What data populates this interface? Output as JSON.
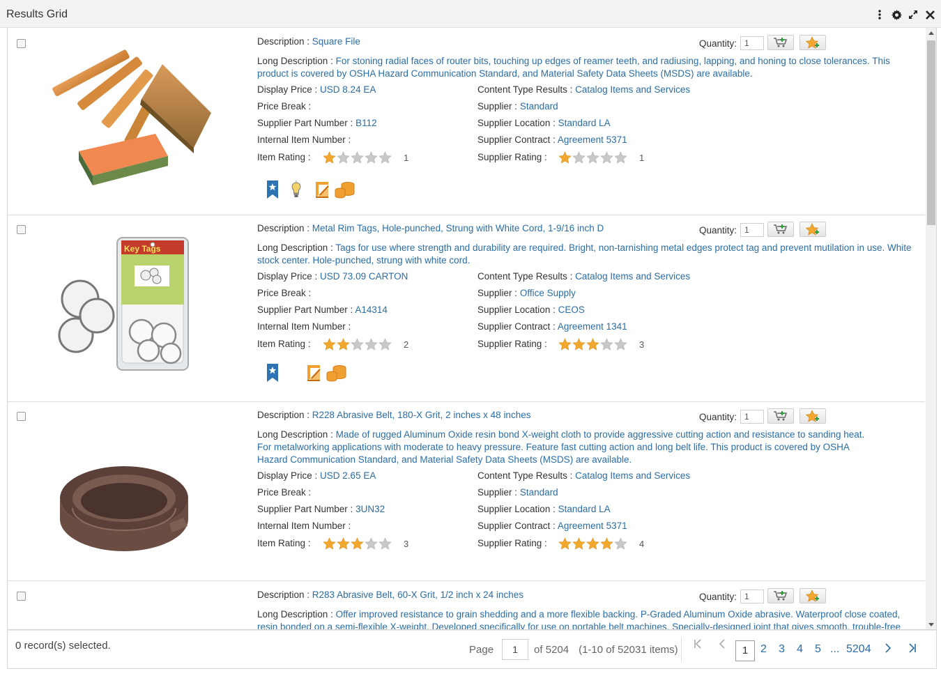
{
  "window": {
    "title": "Results Grid"
  },
  "labels": {
    "description": "Description :",
    "long_description": "Long Description :",
    "display_price": "Display Price :",
    "price_break": "Price Break :",
    "supplier_part_number": "Supplier Part Number :",
    "internal_item_number": "Internal Item Number :",
    "item_rating": "Item Rating :",
    "content_type_results": "Content Type Results :",
    "supplier": "Supplier :",
    "supplier_location": "Supplier Location :",
    "supplier_contract": "Supplier Contract :",
    "supplier_rating": "Supplier Rating :",
    "quantity": "Quantity:"
  },
  "items": [
    {
      "description": "Square File",
      "long_description": "For stoning radial faces of router bits, touching up edges of reamer teeth, and radiusing, lapping, and honing to close tolerances. This product is covered by OSHA Hazard Communication Standard, and Material Safety Data Sheets (MSDS) are available.",
      "display_price": "USD 8.24 EA",
      "price_break": "",
      "supplier_part_number": "B112",
      "internal_item_number": "",
      "item_rating": 1,
      "item_rating_text": "1",
      "content_type_results": "Catalog Items and Services",
      "supplier": "Standard",
      "supplier_location": "Standard LA",
      "supplier_contract": "Agreement 5371",
      "supplier_rating": 1,
      "supplier_rating_text": "1",
      "quantity": "1",
      "image": "sharpening-stones",
      "badges": [
        "bookmark-icon",
        "bulb-icon",
        "contract-icon",
        "coins-icon"
      ]
    },
    {
      "description": "Metal Rim Tags, Hole-punched, Strung with White Cord, 1-9/16 inch D",
      "long_description": "Tags for use where strength and durability are required. Bright, non-tarnishing metal edges protect tag and prevent mutilation in use. White stock center. Hole-punched, strung with white cord.",
      "display_price": "USD 73.09 CARTON",
      "price_break": "",
      "supplier_part_number": "A14314",
      "internal_item_number": "",
      "item_rating": 2,
      "item_rating_text": "2",
      "content_type_results": "Catalog Items and Services",
      "supplier": "Office Supply",
      "supplier_location": "CEOS",
      "supplier_contract": "Agreement 1341",
      "supplier_rating": 3,
      "supplier_rating_text": "3",
      "quantity": "1",
      "image": "key-tags",
      "image_text": "Key Tags",
      "badges": [
        "bookmark-icon",
        "contract-icon",
        "coins-icon"
      ]
    },
    {
      "description": "R228 Abrasive Belt, 180-X Grit, 2 inches x 48 inches",
      "long_description": "Made of rugged Aluminum Oxide resin bond X-weight cloth to provide aggressive cutting action and resistance to sanding heat. For metalworking applications with moderate to heavy pressure. Feature fast cutting action and long belt life. This product is covered by OSHA Hazard Communication Standard, and Material Safety Data Sheets (MSDS) are available.",
      "display_price": "USD 2.65 EA",
      "price_break": "",
      "supplier_part_number": "3UN32",
      "internal_item_number": "",
      "item_rating": 3,
      "item_rating_text": "3",
      "content_type_results": "Catalog Items and Services",
      "supplier": "Standard",
      "supplier_location": "Standard LA",
      "supplier_contract": "Agreement 5371",
      "supplier_rating": 4,
      "supplier_rating_text": "4",
      "quantity": "1",
      "image": "abrasive-belt",
      "badges": []
    },
    {
      "description": "R283 Abrasive Belt, 60-X Grit, 1/2 inch x 24 inches",
      "long_description": "Offer improved resistance to grain shedding and a more flexible backing. P-Graded Aluminum Oxide abrasive. Waterproof close coated, resin bonded on a semi-flexible X-weight. Developed specifically for use on portable belt machines. Specially-designed joint that gives smooth, trouble-free",
      "quantity": "1",
      "badges": []
    }
  ],
  "footer": {
    "selected_text": "0 record(s) selected.",
    "page_label": "Page",
    "page_value": "1",
    "of_pages": "of 5204",
    "items_range": "(1-10 of 52031 items)",
    "pages": [
      "1",
      "2",
      "3",
      "4",
      "5",
      "...",
      "5204"
    ],
    "current_page": "1"
  },
  "colors": {
    "link": "#2a6da8",
    "star_on": "#f2a830",
    "star_off": "#c8c8c8",
    "badge_blue": "#2e74b5",
    "badge_orange": "#f0a030"
  }
}
